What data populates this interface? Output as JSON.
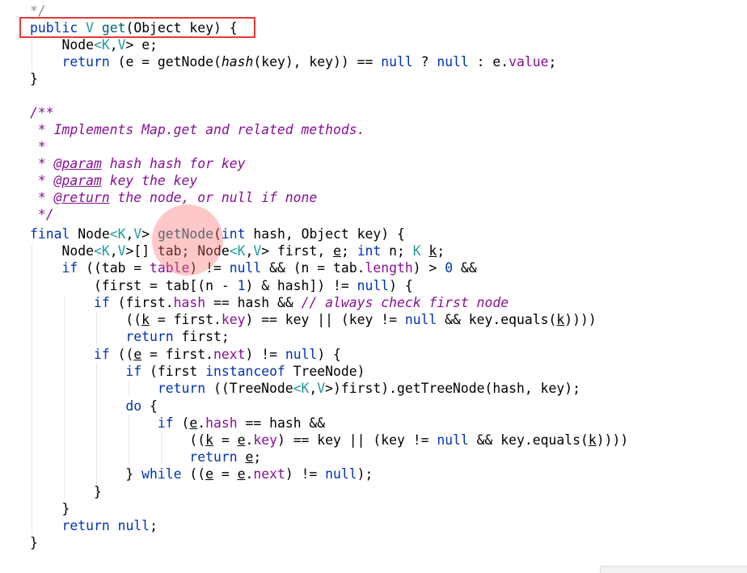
{
  "code": {
    "line01": {
      "t1": "*/"
    },
    "line02": {
      "t1": "public",
      "t2": " ",
      "t3": "V",
      "t4": " ",
      "t5": "get",
      "t6": "(Object key) {"
    },
    "line03": {
      "t1": "    Node",
      "t2": "<",
      "t3": "K",
      "t4": ",",
      "t5": "V",
      "t6": "> e;"
    },
    "line04": {
      "t1": "    ",
      "t2": "return",
      "t3": " (e = getNode(",
      "t4": "hash",
      "t5": "(key), key)) == ",
      "t6": "null",
      "t7": " ? ",
      "t8": "null",
      "t9": " : e.",
      "t10": "value",
      "t11": ";"
    },
    "line05": {
      "t1": "}"
    },
    "line07": {
      "t1": "/**"
    },
    "line08": {
      "t1": " * Implements Map.get and related methods."
    },
    "line09": {
      "t1": " *"
    },
    "line10": {
      "t1": " * ",
      "t2": "@param",
      "t3": " hash hash for key"
    },
    "line11": {
      "t1": " * ",
      "t2": "@param",
      "t3": " key the key"
    },
    "line12": {
      "t1": " * ",
      "t2": "@return",
      "t3": " the node, or null if none"
    },
    "line13": {
      "t1": " */"
    },
    "line14": {
      "t1": "final",
      "t2": " Node",
      "t3": "<",
      "t4": "K",
      "t5": ",",
      "t6": "V",
      "t7": "> ",
      "t8": "getNode",
      "t9": "(",
      "t10": "int",
      "t11": " hash, Object key) {"
    },
    "line15": {
      "t1": "    Node",
      "t2": "<",
      "t3": "K",
      "t4": ",",
      "t5": "V",
      "t6": ">[] tab; Node",
      "t7": "<",
      "t8": "K",
      "t9": ",",
      "t10": "V",
      "t11": "> first, ",
      "t12": "e",
      "t13": "; ",
      "t14": "int",
      "t15": " n; ",
      "t16": "K",
      "t17": " ",
      "t18": "k",
      "t19": ";"
    },
    "line16": {
      "t1": "    ",
      "t2": "if",
      "t3": " ((tab = ",
      "t4": "table",
      "t5": ") != ",
      "t6": "null",
      "t7": " && (n = tab.",
      "t8": "length",
      "t9": ") > ",
      "t10": "0",
      "t11": " &&"
    },
    "line17": {
      "t1": "        (first = tab[(n - ",
      "t2": "1",
      "t3": ") & hash]) != ",
      "t4": "null",
      "t5": ") {"
    },
    "line18": {
      "t1": "        ",
      "t2": "if",
      "t3": " (first.",
      "t4": "hash",
      "t5": " == hash && ",
      "t6": "// always check first node"
    },
    "line19": {
      "t1": "            ((",
      "t2": "k",
      "t3": " = first.",
      "t4": "key",
      "t5": ") == key || (key != ",
      "t6": "null",
      "t7": " && key.equals(",
      "t8": "k",
      "t9": "))))"
    },
    "line20": {
      "t1": "            ",
      "t2": "return",
      "t3": " first;"
    },
    "line21": {
      "t1": "        ",
      "t2": "if",
      "t3": " ((",
      "t4": "e",
      "t5": " = first.",
      "t6": "next",
      "t7": ") != ",
      "t8": "null",
      "t9": ") {"
    },
    "line22": {
      "t1": "            ",
      "t2": "if",
      "t3": " (first ",
      "t4": "instanceof",
      "t5": " TreeNode)"
    },
    "line23": {
      "t1": "                ",
      "t2": "return",
      "t3": " ((TreeNode",
      "t4": "<",
      "t5": "K",
      "t6": ",",
      "t7": "V",
      "t8": ">)first).getTreeNode(hash, key);"
    },
    "line24": {
      "t1": "            ",
      "t2": "do",
      "t3": " {"
    },
    "line25": {
      "t1": "                ",
      "t2": "if",
      "t3": " (",
      "t4": "e",
      "t5": ".",
      "t6": "hash",
      "t7": " == hash &&"
    },
    "line26": {
      "t1": "                    ((",
      "t2": "k",
      "t3": " = ",
      "t4": "e",
      "t5": ".",
      "t6": "key",
      "t7": ") == key || (key != ",
      "t8": "null",
      "t9": " && key.equals(",
      "t10": "k",
      "t11": "))))"
    },
    "line27": {
      "t1": "                    ",
      "t2": "return",
      "t3": " ",
      "t4": "e",
      "t5": ";"
    },
    "line28": {
      "t1": "            } ",
      "t2": "while",
      "t3": " ((",
      "t4": "e",
      "t5": " = ",
      "t6": "e",
      "t7": ".",
      "t8": "next",
      "t9": ") != ",
      "t10": "null",
      "t11": ");"
    },
    "line29": {
      "t1": "        }"
    },
    "line30": {
      "t1": "    }"
    },
    "line31": {
      "t1": "    ",
      "t2": "return",
      "t3": " ",
      "t4": "null",
      "t5": ";"
    },
    "line32": {
      "t1": "}"
    }
  },
  "colors": {
    "keyword": "#0033b3",
    "comment": "#8c8c8c",
    "doc_comment": "#871094",
    "field": "#871094",
    "type_param": "#20999d",
    "method_decl": "#00627a",
    "highlight_box": "#e53935",
    "cursor_indicator": "#ff6e6e"
  }
}
